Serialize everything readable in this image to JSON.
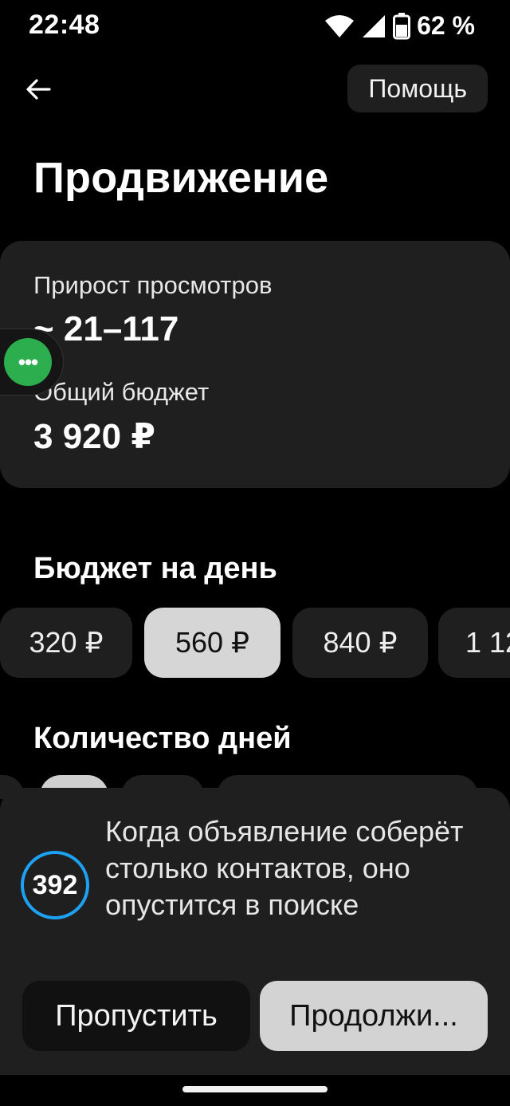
{
  "status_bar": {
    "time": "22:48",
    "battery": "62 %"
  },
  "header": {
    "help_label": "Помощь"
  },
  "page": {
    "title": "Продвижение"
  },
  "summary": {
    "views_label": "Прирост просмотров",
    "views_value": "~ 21–117",
    "budget_label": "Общий бюджет",
    "budget_value": "3 920 ₽"
  },
  "daily_budget": {
    "title": "Бюджет на день",
    "options": [
      "320 ₽",
      "560 ₽",
      "840 ₽",
      "1 12"
    ],
    "selected": "560 ₽"
  },
  "days": {
    "title": "Количество дней"
  },
  "sheet": {
    "counter": "392",
    "text": "Когда объявление соберёт столько контактов, оно опустится в поиске",
    "skip_label": "Пропустить",
    "continue_label": "Продолжи..."
  },
  "icons": {
    "back": "arrow-left-icon",
    "floating": "more-dots-icon"
  },
  "colors": {
    "accent_ring": "#1da1f2",
    "bubble": "#2cae4f"
  }
}
